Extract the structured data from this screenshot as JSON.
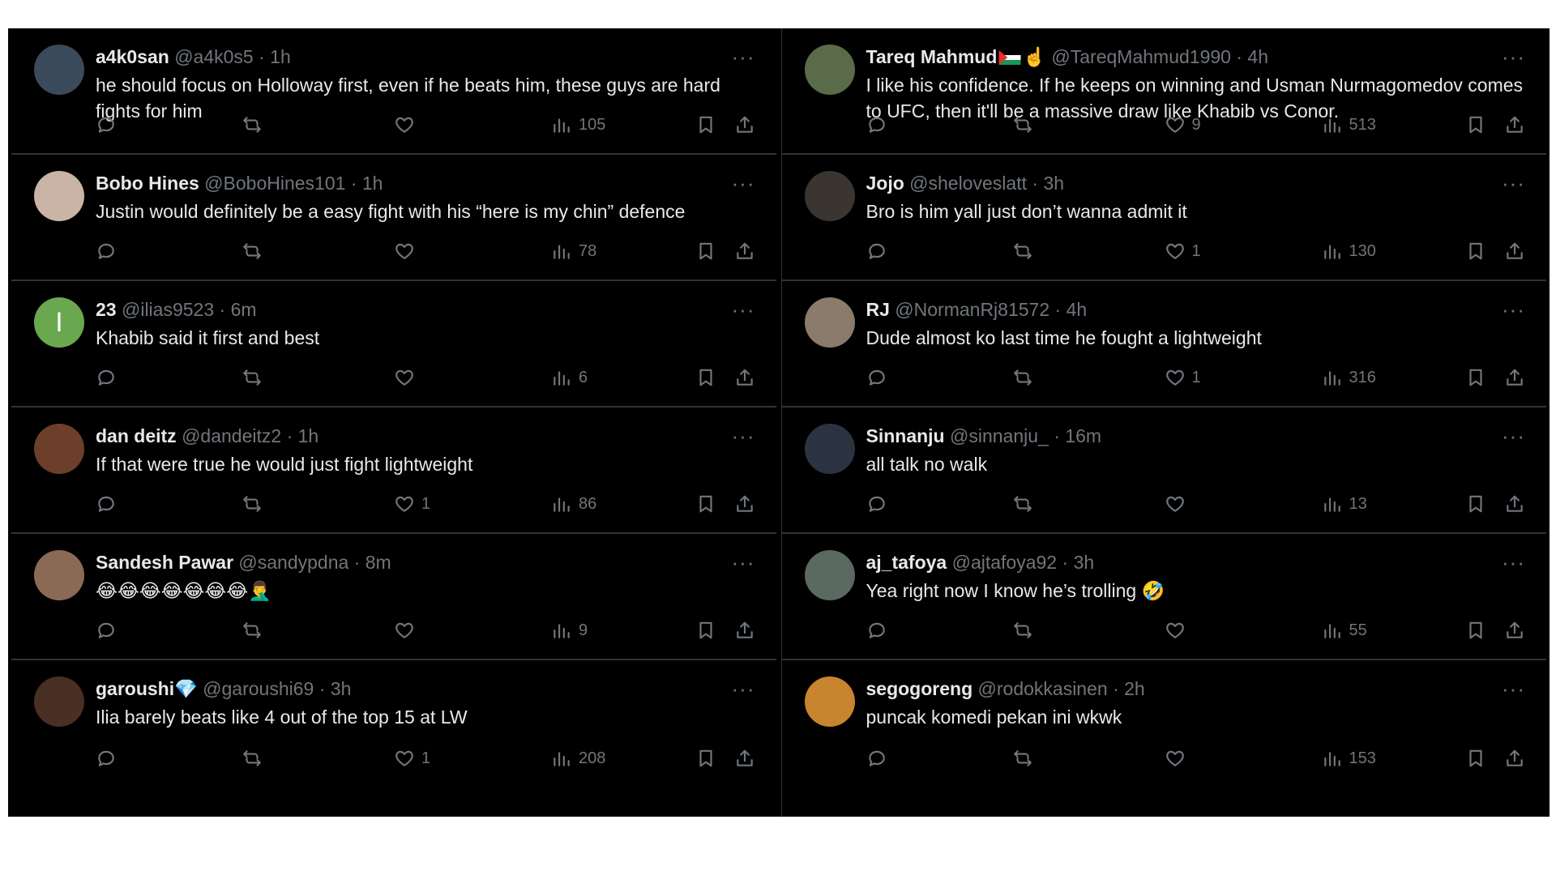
{
  "columns": [
    {
      "tweets": [
        {
          "name": "a4k0san",
          "handle": "@a4k0s5",
          "time": "1h",
          "text": "he should focus on Holloway first, even if he beats him, these guys are hard fights for him",
          "likes": "",
          "views": "105",
          "avatar_color": "#3a4a5a"
        },
        {
          "name": "Bobo Hines",
          "handle": "@BoboHines101",
          "time": "1h",
          "text": "Justin would definitely be a easy fight with his “here is my chin” defence",
          "likes": "",
          "views": "78",
          "avatar_color": "#c9b4a5"
        },
        {
          "name": "23",
          "handle": "@ilias9523",
          "time": "6m",
          "text": "Khabib said it first and best",
          "likes": "",
          "views": "6",
          "avatar_color": "#6aa84f",
          "avatar_letter": "I"
        },
        {
          "name": "dan deitz",
          "handle": "@dandeitz2",
          "time": "1h",
          "text": "If that were true he would just fight lightweight",
          "likes": "1",
          "views": "86",
          "avatar_color": "#6b3f2a"
        },
        {
          "name": "Sandesh Pawar",
          "handle": "@sandypdna",
          "time": "8m",
          "text": "😂😂😂😂😂😂😂🤦‍♂️",
          "likes": "",
          "views": "9",
          "avatar_color": "#8a6a55"
        },
        {
          "name": "garoushi💎",
          "handle": "@garoushi69",
          "time": "3h",
          "text": "Ilia barely beats like 4 out of the top 15 at LW",
          "likes": "1",
          "views": "208",
          "avatar_color": "#4a2f25"
        }
      ]
    },
    {
      "tweets": [
        {
          "name": "Tareq Mahmud",
          "name_extra": "☝️",
          "handle": "@TareqMahmud1990",
          "time": "4h",
          "text": "I like his confidence. If he keeps on winning and Usman Nurmagomedov comes to UFC, then it'll be a massive draw like Khabib vs Conor.",
          "likes": "9",
          "views": "513",
          "avatar_color": "#5a6b4a",
          "flag": true
        },
        {
          "name": "Jojo",
          "handle": "@sheloveslatt",
          "time": "3h",
          "text": "Bro is him yall just don’t wanna admit it",
          "likes": "1",
          "views": "130",
          "avatar_color": "#3a3530"
        },
        {
          "name": "RJ",
          "handle": "@NormanRj81572",
          "time": "4h",
          "text": "Dude almost ko last time he fought a lightweight",
          "likes": "1",
          "views": "316",
          "avatar_color": "#8a7b6a"
        },
        {
          "name": "Sinnanju",
          "handle": "@sinnanju_",
          "time": "16m",
          "text": "all talk no walk",
          "likes": "",
          "views": "13",
          "avatar_color": "#2c3340"
        },
        {
          "name": "aj_tafoya",
          "handle": "@ajtafoya92",
          "time": "3h",
          "text": "Yea right now I know he’s trolling 🤣",
          "likes": "",
          "views": "55",
          "avatar_color": "#5b6a60"
        },
        {
          "name": "segogoreng",
          "handle": "@rodokkasinen",
          "time": "2h",
          "text": "puncak komedi pekan ini wkwk",
          "likes": "",
          "views": "153",
          "avatar_color": "#c8842e"
        }
      ]
    }
  ],
  "colors": {
    "background": "#000000",
    "name": "#e7e9ea",
    "secondary": "#71767b",
    "divider": "#2f3336"
  },
  "icons": [
    "reply-icon",
    "repost-icon",
    "like-icon",
    "views-icon",
    "bookmark-icon",
    "share-icon",
    "more-icon"
  ]
}
